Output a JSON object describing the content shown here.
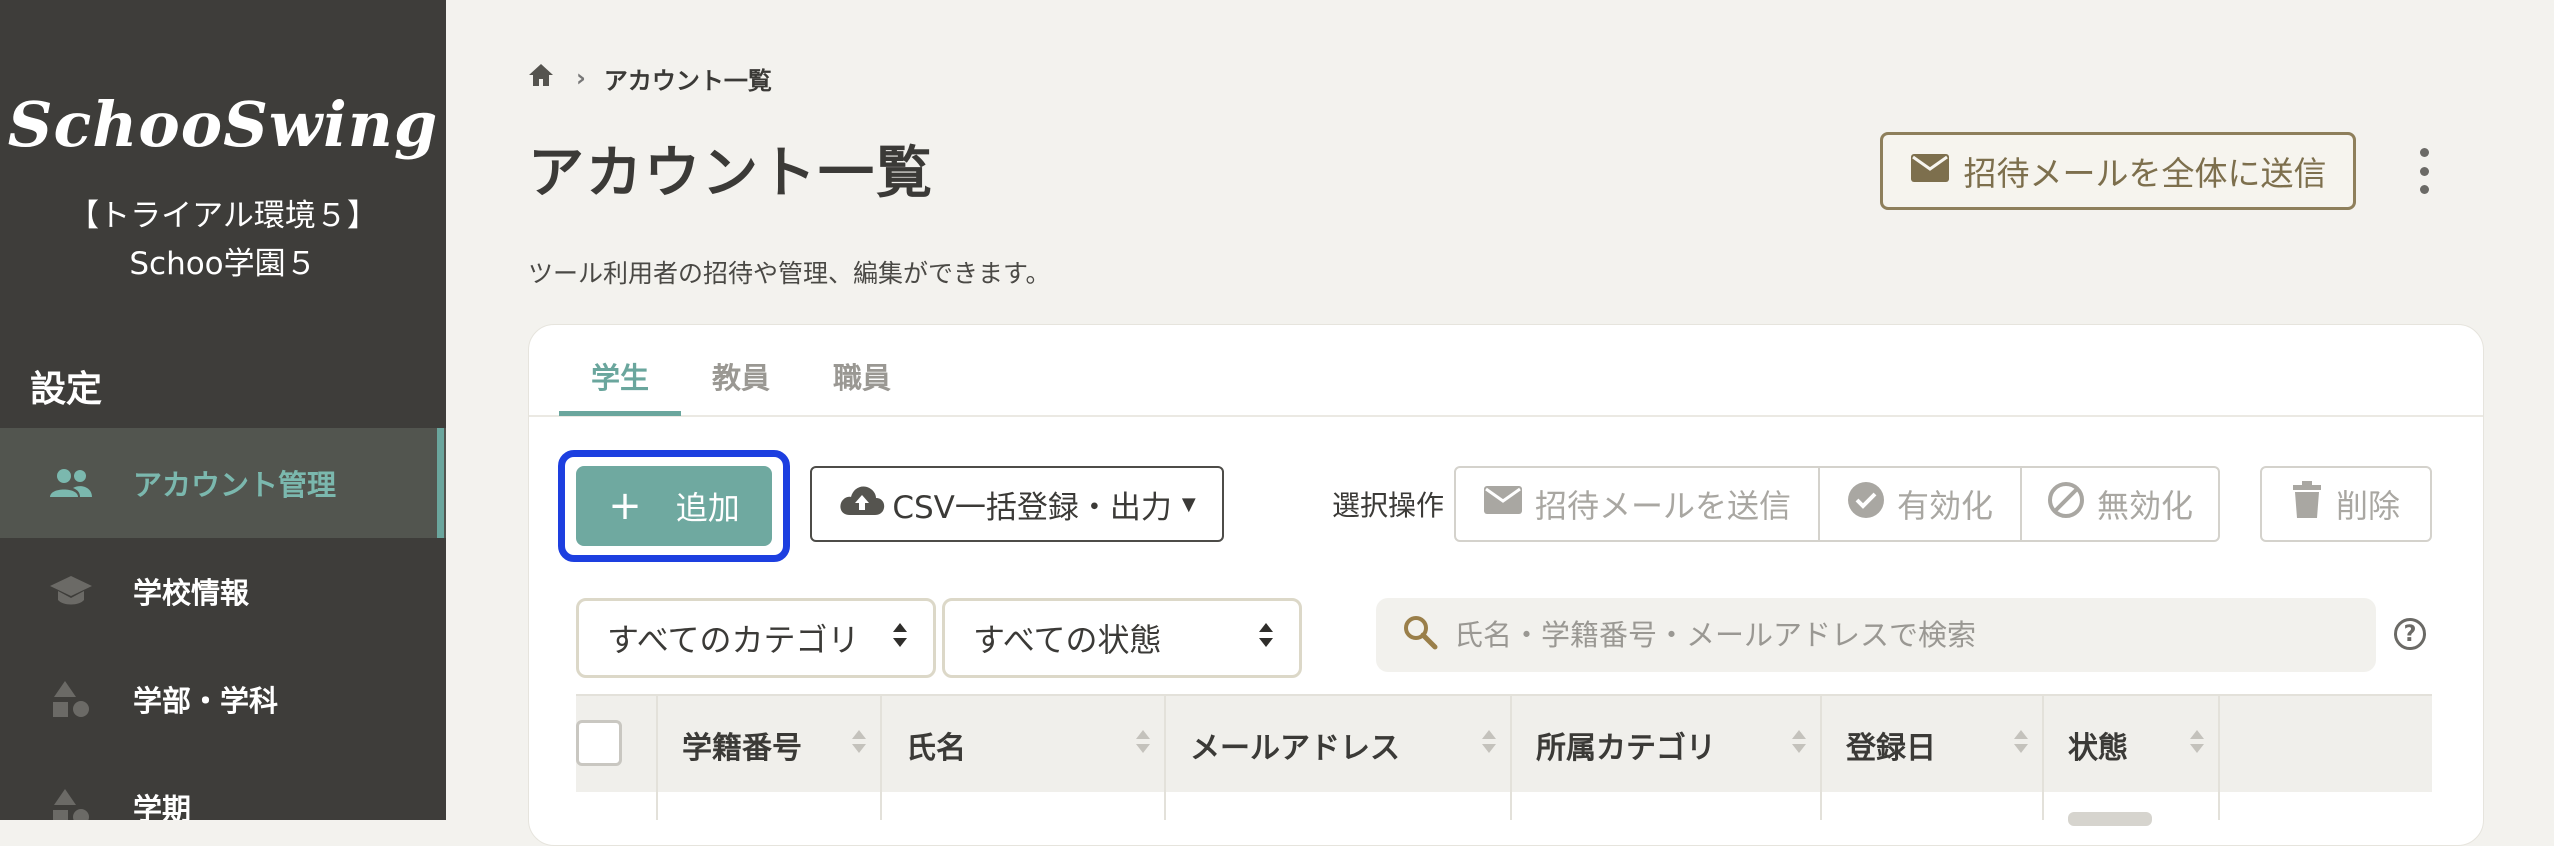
{
  "sidebar": {
    "logo": "SchooSwing",
    "org_name": "【トライアル環境５】Schoo学園５",
    "settings_heading": "設定",
    "items": [
      {
        "label": "アカウント管理",
        "icon": "people-icon",
        "active": true
      },
      {
        "label": "学校情報",
        "icon": "graduation-cap-icon",
        "active": false
      },
      {
        "label": "学部・学科",
        "icon": "shapes-icon",
        "active": false
      },
      {
        "label": "学期",
        "icon": "shapes-icon",
        "active": false
      }
    ]
  },
  "header": {
    "breadcrumb": {
      "home_icon": "home-icon",
      "current": "アカウント一覧"
    },
    "title": "アカウント一覧",
    "description": "ツール利用者の招待や管理、編集ができます。",
    "invite_all_label": "招待メールを全体に送信",
    "more_icon": "more-vertical-icon"
  },
  "tabs": [
    {
      "label": "学生",
      "active": true
    },
    {
      "label": "教員",
      "active": false
    },
    {
      "label": "職員",
      "active": false
    }
  ],
  "toolbar": {
    "add_label": "追加",
    "csv_label": "CSV一括登録・出力",
    "selection_label": "選択操作",
    "send_invite_label": "招待メールを送信",
    "enable_label": "有効化",
    "disable_label": "無効化",
    "delete_label": "削除"
  },
  "filters": {
    "category_value": "すべてのカテゴリ",
    "status_value": "すべての状態",
    "search_placeholder": "氏名・学籍番号・メールアドレスで検索"
  },
  "table": {
    "columns": [
      "学籍番号",
      "氏名",
      "メールアドレス",
      "所属カテゴリ",
      "登録日",
      "状態"
    ]
  },
  "colors": {
    "sidebar_bg": "#3e3d3a",
    "accent": "#6aa69d",
    "gold_border": "#8e7f5b",
    "focus_ring": "#1d3fe0"
  }
}
